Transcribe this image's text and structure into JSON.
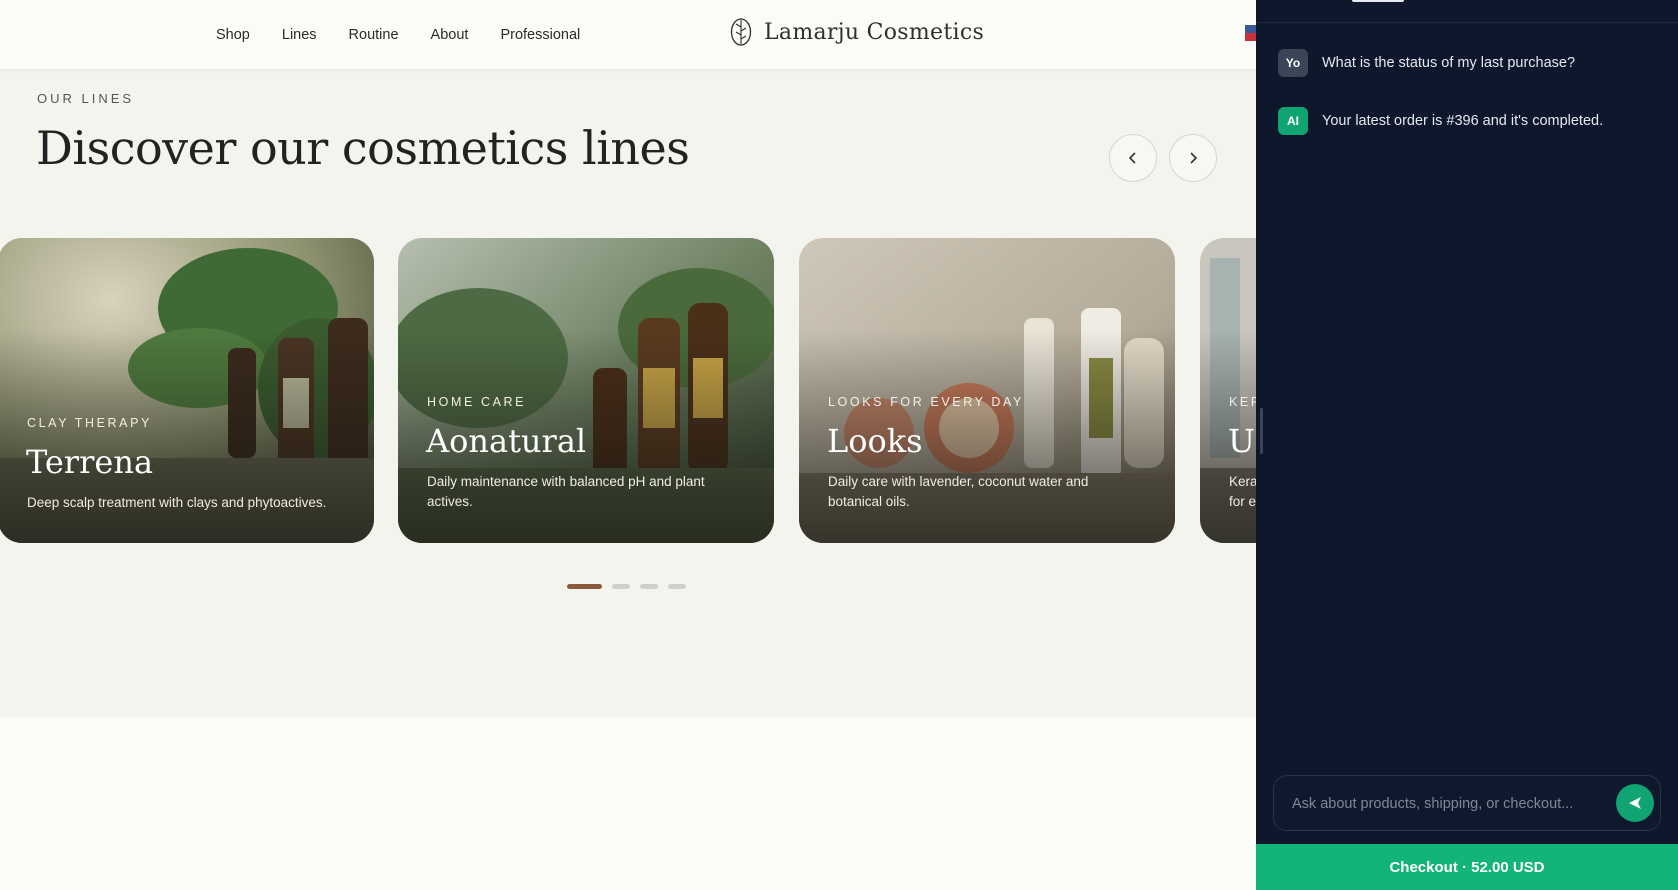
{
  "header": {
    "nav": [
      "Shop",
      "Lines",
      "Routine",
      "About",
      "Professional"
    ],
    "brand": "Lamarju Cosmetics"
  },
  "section": {
    "eyebrow": "OUR LINES",
    "title": "Discover our cosmetics lines",
    "cards": [
      {
        "category": "CLAY THERAPY",
        "name": "Terrena",
        "description": "Deep scalp treatment with clays and phytoactives."
      },
      {
        "category": "HOME CARE",
        "name": "Aonatural",
        "description": "Daily maintenance with balanced pH and plant actives."
      },
      {
        "category": "LOOKS FOR EVERY DAY",
        "name": "Looks",
        "description": "Daily care with lavender, coconut water and botanical oils."
      },
      {
        "category": "KER",
        "name": "U",
        "description": "Kera\nfor e"
      }
    ],
    "pagination": {
      "pages": 4,
      "active": 1
    }
  },
  "chat": {
    "messages": [
      {
        "avatar": "Yo",
        "text": "What is the status of my last purchase?"
      },
      {
        "avatar": "AI",
        "text": "Your latest order is #396 and it's completed."
      }
    ],
    "input_placeholder": "Ask about products, shipping, or checkout...",
    "checkout_label": "Checkout · 52.00 USD"
  },
  "colors": {
    "chat_bg": "#0e172b",
    "accent": "#10a472",
    "checkout": "#12b478",
    "pager_active": "#8a5a3c"
  },
  "icons": [
    "leaf-logo-icon",
    "chevron-left-icon",
    "chevron-right-icon",
    "send-icon",
    "us-flag-icon"
  ]
}
